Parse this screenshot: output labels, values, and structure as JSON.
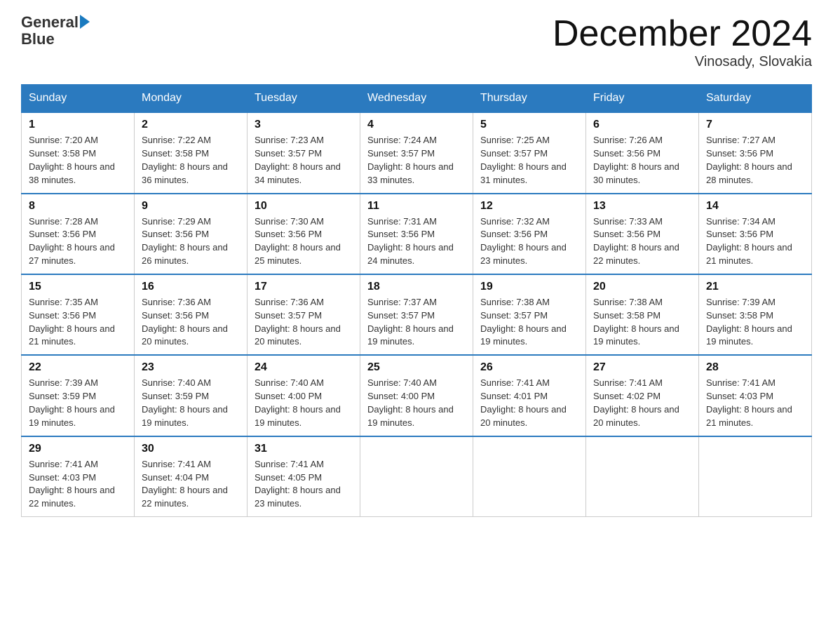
{
  "header": {
    "logo_general": "General",
    "logo_blue": "Blue",
    "month_title": "December 2024",
    "location": "Vinosady, Slovakia"
  },
  "days_of_week": [
    "Sunday",
    "Monday",
    "Tuesday",
    "Wednesday",
    "Thursday",
    "Friday",
    "Saturday"
  ],
  "weeks": [
    [
      {
        "day": "1",
        "sunrise": "7:20 AM",
        "sunset": "3:58 PM",
        "daylight": "8 hours and 38 minutes."
      },
      {
        "day": "2",
        "sunrise": "7:22 AM",
        "sunset": "3:58 PM",
        "daylight": "8 hours and 36 minutes."
      },
      {
        "day": "3",
        "sunrise": "7:23 AM",
        "sunset": "3:57 PM",
        "daylight": "8 hours and 34 minutes."
      },
      {
        "day": "4",
        "sunrise": "7:24 AM",
        "sunset": "3:57 PM",
        "daylight": "8 hours and 33 minutes."
      },
      {
        "day": "5",
        "sunrise": "7:25 AM",
        "sunset": "3:57 PM",
        "daylight": "8 hours and 31 minutes."
      },
      {
        "day": "6",
        "sunrise": "7:26 AM",
        "sunset": "3:56 PM",
        "daylight": "8 hours and 30 minutes."
      },
      {
        "day": "7",
        "sunrise": "7:27 AM",
        "sunset": "3:56 PM",
        "daylight": "8 hours and 28 minutes."
      }
    ],
    [
      {
        "day": "8",
        "sunrise": "7:28 AM",
        "sunset": "3:56 PM",
        "daylight": "8 hours and 27 minutes."
      },
      {
        "day": "9",
        "sunrise": "7:29 AM",
        "sunset": "3:56 PM",
        "daylight": "8 hours and 26 minutes."
      },
      {
        "day": "10",
        "sunrise": "7:30 AM",
        "sunset": "3:56 PM",
        "daylight": "8 hours and 25 minutes."
      },
      {
        "day": "11",
        "sunrise": "7:31 AM",
        "sunset": "3:56 PM",
        "daylight": "8 hours and 24 minutes."
      },
      {
        "day": "12",
        "sunrise": "7:32 AM",
        "sunset": "3:56 PM",
        "daylight": "8 hours and 23 minutes."
      },
      {
        "day": "13",
        "sunrise": "7:33 AM",
        "sunset": "3:56 PM",
        "daylight": "8 hours and 22 minutes."
      },
      {
        "day": "14",
        "sunrise": "7:34 AM",
        "sunset": "3:56 PM",
        "daylight": "8 hours and 21 minutes."
      }
    ],
    [
      {
        "day": "15",
        "sunrise": "7:35 AM",
        "sunset": "3:56 PM",
        "daylight": "8 hours and 21 minutes."
      },
      {
        "day": "16",
        "sunrise": "7:36 AM",
        "sunset": "3:56 PM",
        "daylight": "8 hours and 20 minutes."
      },
      {
        "day": "17",
        "sunrise": "7:36 AM",
        "sunset": "3:57 PM",
        "daylight": "8 hours and 20 minutes."
      },
      {
        "day": "18",
        "sunrise": "7:37 AM",
        "sunset": "3:57 PM",
        "daylight": "8 hours and 19 minutes."
      },
      {
        "day": "19",
        "sunrise": "7:38 AM",
        "sunset": "3:57 PM",
        "daylight": "8 hours and 19 minutes."
      },
      {
        "day": "20",
        "sunrise": "7:38 AM",
        "sunset": "3:58 PM",
        "daylight": "8 hours and 19 minutes."
      },
      {
        "day": "21",
        "sunrise": "7:39 AM",
        "sunset": "3:58 PM",
        "daylight": "8 hours and 19 minutes."
      }
    ],
    [
      {
        "day": "22",
        "sunrise": "7:39 AM",
        "sunset": "3:59 PM",
        "daylight": "8 hours and 19 minutes."
      },
      {
        "day": "23",
        "sunrise": "7:40 AM",
        "sunset": "3:59 PM",
        "daylight": "8 hours and 19 minutes."
      },
      {
        "day": "24",
        "sunrise": "7:40 AM",
        "sunset": "4:00 PM",
        "daylight": "8 hours and 19 minutes."
      },
      {
        "day": "25",
        "sunrise": "7:40 AM",
        "sunset": "4:00 PM",
        "daylight": "8 hours and 19 minutes."
      },
      {
        "day": "26",
        "sunrise": "7:41 AM",
        "sunset": "4:01 PM",
        "daylight": "8 hours and 20 minutes."
      },
      {
        "day": "27",
        "sunrise": "7:41 AM",
        "sunset": "4:02 PM",
        "daylight": "8 hours and 20 minutes."
      },
      {
        "day": "28",
        "sunrise": "7:41 AM",
        "sunset": "4:03 PM",
        "daylight": "8 hours and 21 minutes."
      }
    ],
    [
      {
        "day": "29",
        "sunrise": "7:41 AM",
        "sunset": "4:03 PM",
        "daylight": "8 hours and 22 minutes."
      },
      {
        "day": "30",
        "sunrise": "7:41 AM",
        "sunset": "4:04 PM",
        "daylight": "8 hours and 22 minutes."
      },
      {
        "day": "31",
        "sunrise": "7:41 AM",
        "sunset": "4:05 PM",
        "daylight": "8 hours and 23 minutes."
      },
      null,
      null,
      null,
      null
    ]
  ],
  "labels": {
    "sunrise_prefix": "Sunrise: ",
    "sunset_prefix": "Sunset: ",
    "daylight_prefix": "Daylight: "
  }
}
